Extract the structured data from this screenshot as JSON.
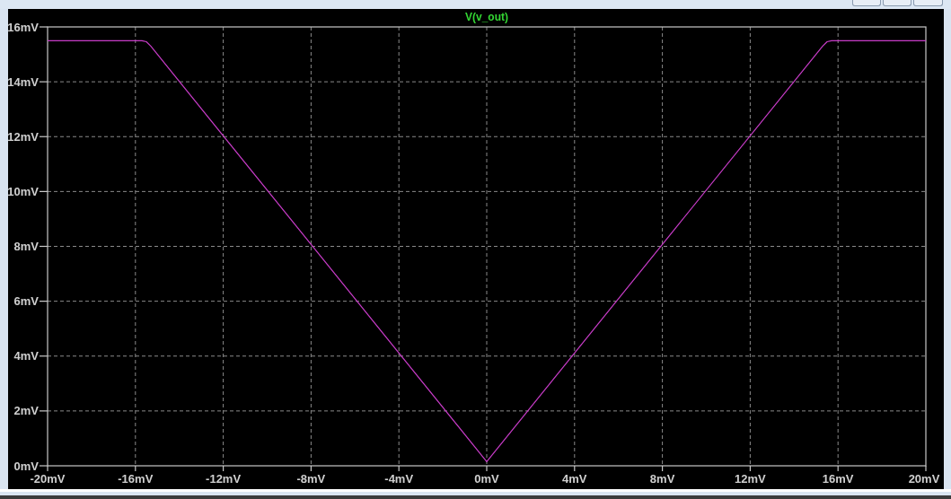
{
  "window": {
    "controls": [
      {
        "kind": "minimize"
      },
      {
        "kind": "maximize"
      },
      {
        "kind": "close"
      }
    ]
  },
  "plot": {
    "chart_data": {
      "type": "line",
      "title": "V(v_out)",
      "grid": true,
      "x": [
        -20,
        -15.7,
        -15.5,
        -15.3,
        0,
        15.3,
        15.5,
        15.7,
        20
      ],
      "series": [
        {
          "color": "#c83cc8",
          "values": [
            15.5,
            15.5,
            15.46,
            15.3,
            0.15,
            15.3,
            15.46,
            15.5,
            15.5
          ]
        }
      ],
      "xlim": [
        -20,
        20
      ],
      "ylim": [
        0,
        16
      ],
      "xticks": [
        {
          "value": -20,
          "label": "-20mV"
        },
        {
          "value": -16,
          "label": "-16mV"
        },
        {
          "value": -12,
          "label": "-12mV"
        },
        {
          "value": -8,
          "label": "-8mV"
        },
        {
          "value": -4,
          "label": "-4mV"
        },
        {
          "value": 0,
          "label": "0mV"
        },
        {
          "value": 4,
          "label": "4mV"
        },
        {
          "value": 8,
          "label": "8mV"
        },
        {
          "value": 12,
          "label": "12mV"
        },
        {
          "value": 16,
          "label": "16mV"
        },
        {
          "value": 20,
          "label": "20mV"
        }
      ],
      "yticks": [
        {
          "value": 0,
          "label": "0mV"
        },
        {
          "value": 2,
          "label": "2mV"
        },
        {
          "value": 4,
          "label": "4mV"
        },
        {
          "value": 6,
          "label": "6mV"
        },
        {
          "value": 8,
          "label": "8mV"
        },
        {
          "value": 10,
          "label": "10mV"
        },
        {
          "value": 12,
          "label": "12mV"
        },
        {
          "value": 14,
          "label": "14mV"
        },
        {
          "value": 16,
          "label": "16mV"
        }
      ]
    }
  }
}
